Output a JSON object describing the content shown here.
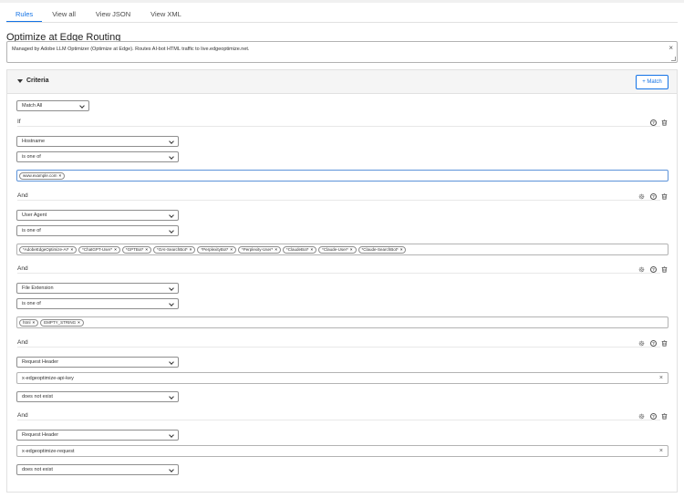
{
  "tabs": [
    "Rules",
    "View all",
    "View JSON",
    "View XML"
  ],
  "page_title": "Optimize at Edge Routing",
  "description": "Managed by Adobe LLM Optimizer (Optimize at Edge). Routes AI-bot HTML traffic to live.edgeoptimize.net.",
  "criteria": {
    "title": "Criteria",
    "match_button": "+ Match",
    "match_mode": "Match All",
    "if_label": "If",
    "and_label": "And",
    "help_glyph": "?",
    "clear_glyph": "×",
    "conditions": [
      {
        "field": "Hostname",
        "operator": "is one of",
        "tags": [
          "www.example.com"
        ]
      },
      {
        "field": "User Agent",
        "operator": "is one of",
        "tags": [
          "*AdobeEdgeOptimize-AI*",
          "*ChatGPT-User*",
          "*GPTBot*",
          "*OAI-SearchBot*",
          "*PerplexityBot*",
          "*Perplexity-User*",
          "*ClaudeBot*",
          "*Claude-User*",
          "*Claude-SearchBot*"
        ]
      },
      {
        "field": "File Extension",
        "operator": "is one of",
        "tags": [
          "html",
          "EMPTY_STRING"
        ]
      },
      {
        "field": "Request Header",
        "header": "x-edgeoptimize-api-key",
        "operator": "does not exist"
      },
      {
        "field": "Request Header",
        "header": "x-edgeoptimize-request",
        "operator": "does not exist"
      }
    ]
  },
  "icons": {
    "caret": "caret-down-icon",
    "help": "help-icon",
    "settings": "gear-icon",
    "delete": "trash-icon",
    "tag_remove": "close-icon"
  },
  "colors": {
    "accent": "#1473e6"
  }
}
